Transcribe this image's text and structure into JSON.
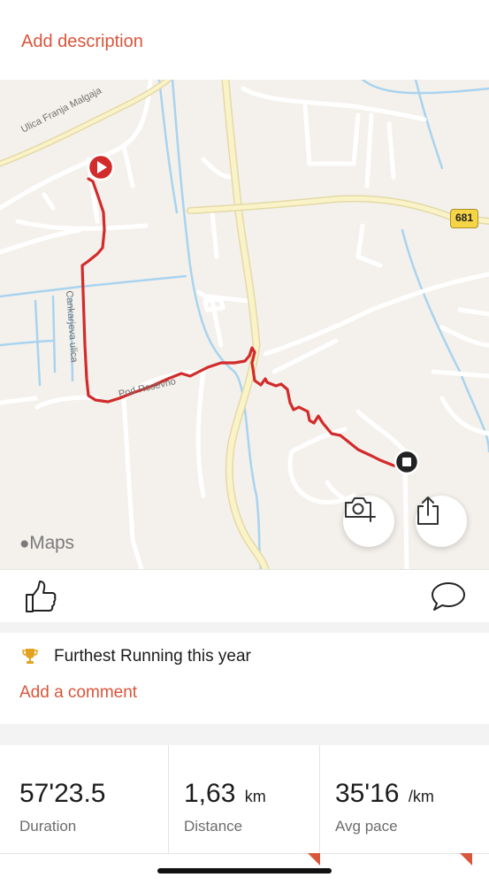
{
  "description": {
    "add_label": "Add description"
  },
  "map": {
    "attribution": "Maps",
    "street_labels": [
      "Ulica Franja Malgaja",
      "Cankarjeva ulica",
      "Pod Resevno"
    ],
    "road_number": "681",
    "route_color": "#d22b2b",
    "buttons": {
      "camera": "camera-add-icon",
      "share": "share-icon"
    }
  },
  "actions": {
    "like": "thumbs-up-icon",
    "comment": "speech-bubble-icon"
  },
  "achievement": {
    "icon": "trophy-icon",
    "text": "Furthest Running this year"
  },
  "comment": {
    "add_label": "Add a comment"
  },
  "stats": [
    {
      "value": "57'23.5",
      "unit": "",
      "label": "Duration"
    },
    {
      "value": "1,63",
      "unit": "km",
      "label": "Distance"
    },
    {
      "value": "35'16",
      "unit": "/km",
      "label": "Avg pace"
    }
  ],
  "colors": {
    "accent": "#d9553b",
    "route": "#d22b2b"
  }
}
